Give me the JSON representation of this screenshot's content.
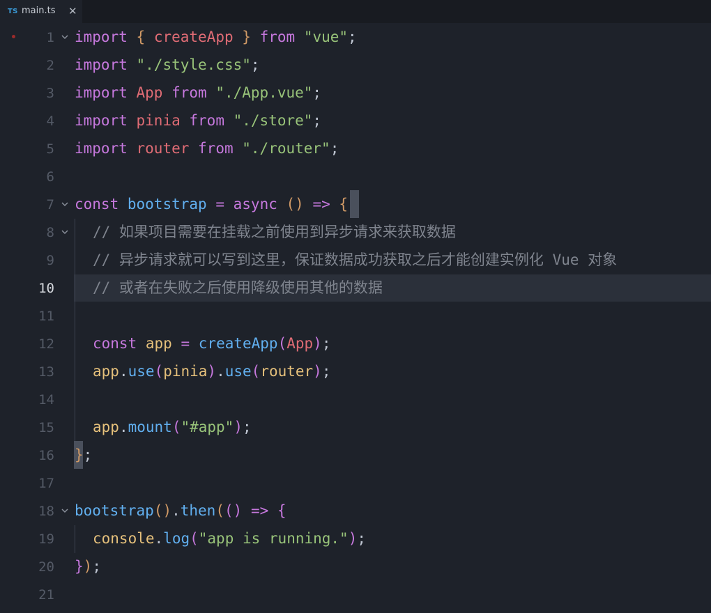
{
  "tab": {
    "lang": "TS",
    "filename": "main.ts",
    "close": "✕"
  },
  "lines": [
    {
      "n": "1"
    },
    {
      "n": "2"
    },
    {
      "n": "3"
    },
    {
      "n": "4"
    },
    {
      "n": "5"
    },
    {
      "n": "6"
    },
    {
      "n": "7"
    },
    {
      "n": "8"
    },
    {
      "n": "9"
    },
    {
      "n": "10"
    },
    {
      "n": "11"
    },
    {
      "n": "12"
    },
    {
      "n": "13"
    },
    {
      "n": "14"
    },
    {
      "n": "15"
    },
    {
      "n": "16"
    },
    {
      "n": "17"
    },
    {
      "n": "18"
    },
    {
      "n": "19"
    },
    {
      "n": "20"
    },
    {
      "n": "21"
    }
  ],
  "code": {
    "l1": {
      "import": "import",
      "ob": "{",
      "name": "createApp",
      "cb": "}",
      "from": "from",
      "src": "\"vue\"",
      "semi": ";"
    },
    "l2": {
      "import": "import",
      "src": "\"./style.css\"",
      "semi": ";"
    },
    "l3": {
      "import": "import",
      "name": "App",
      "from": "from",
      "src": "\"./App.vue\"",
      "semi": ";"
    },
    "l4": {
      "import": "import",
      "name": "pinia",
      "from": "from",
      "src": "\"./store\"",
      "semi": ";"
    },
    "l5": {
      "import": "import",
      "name": "router",
      "from": "from",
      "src": "\"./router\"",
      "semi": ";"
    },
    "l7": {
      "const": "const",
      "name": "bootstrap",
      "eq": "=",
      "async": "async",
      "parens": "()",
      "arrow": "=>",
      "brace": "{"
    },
    "l8": {
      "comment": "// 如果项目需要在挂载之前使用到异步请求来获取数据"
    },
    "l9": {
      "comment": "// 异步请求就可以写到这里，保证数据成功获取之后才能创建实例化 Vue 对象"
    },
    "l10": {
      "comment": "// 或者在失败之后使用降级使用其他的数据"
    },
    "l12": {
      "const": "const",
      "name": "app",
      "eq": "=",
      "fn": "createApp",
      "op": "(",
      "arg": "App",
      "cp": ")",
      "semi": ";"
    },
    "l13": {
      "obj": "app",
      "dot1": ".",
      "fn1": "use",
      "op1": "(",
      "arg1": "pinia",
      "cp1": ")",
      "dot2": ".",
      "fn2": "use",
      "op2": "(",
      "arg2": "router",
      "cp2": ")",
      "semi": ";"
    },
    "l15": {
      "obj": "app",
      "dot": ".",
      "fn": "mount",
      "op": "(",
      "str": "\"#app\"",
      "cp": ")",
      "semi": ";"
    },
    "l16": {
      "brace": "}",
      "semi": ";"
    },
    "l18": {
      "fn": "bootstrap",
      "parens": "()",
      "dot": ".",
      "then": "then",
      "op": "(",
      "inner": "()",
      "arrow": "=>",
      "brace": "{"
    },
    "l19": {
      "obj": "console",
      "dot": ".",
      "fn": "log",
      "op": "(",
      "str": "\"app is running.\"",
      "cp": ")",
      "semi": ";"
    },
    "l20": {
      "brace": "}",
      "cp": ")",
      "semi": ";"
    }
  },
  "colors": {
    "background": "#1e222a",
    "keyword": "#c678dd",
    "string": "#98c379",
    "function": "#61afef",
    "variable": "#e06c75",
    "property": "#e5c07b",
    "comment": "#7f848e",
    "bracket": "#d19a66"
  }
}
